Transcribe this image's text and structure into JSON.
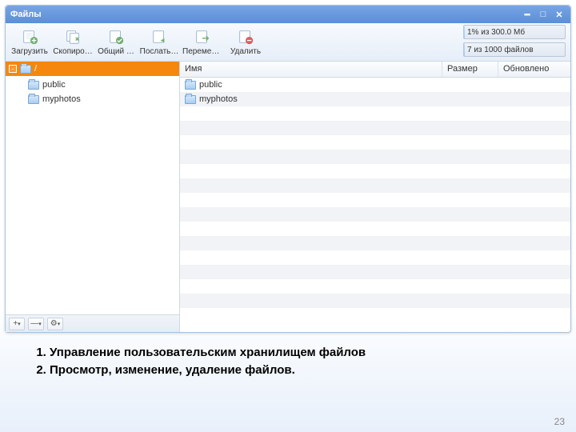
{
  "window": {
    "title": "Файлы"
  },
  "toolbar": {
    "upload": "Загрузить",
    "copy": "Скопиро…",
    "share": "Общий …",
    "send": "Послать…",
    "move": "Перемес…",
    "delete": "Удалить"
  },
  "status": {
    "space": "1% из 300.0 Мб",
    "files": "7 из 1000 файлов",
    "space_pct": 1,
    "files_pct": 0.7
  },
  "tree": {
    "root": "/",
    "items": [
      {
        "label": "public"
      },
      {
        "label": "myphotos"
      }
    ],
    "footer": {
      "add": "+",
      "remove": "—",
      "gear": "⚙"
    }
  },
  "list": {
    "cols": {
      "name": "Имя",
      "size": "Размер",
      "updated": "Обновлено"
    },
    "rows": [
      {
        "name": "public",
        "size": "",
        "updated": ""
      },
      {
        "name": "myphotos",
        "size": "",
        "updated": ""
      }
    ],
    "blank_rows": 14
  },
  "caption": {
    "item1": "Управление пользовательским хранилищем файлов",
    "item2": "Просмотр, изменение, удаление файлов."
  },
  "page_number": "23"
}
